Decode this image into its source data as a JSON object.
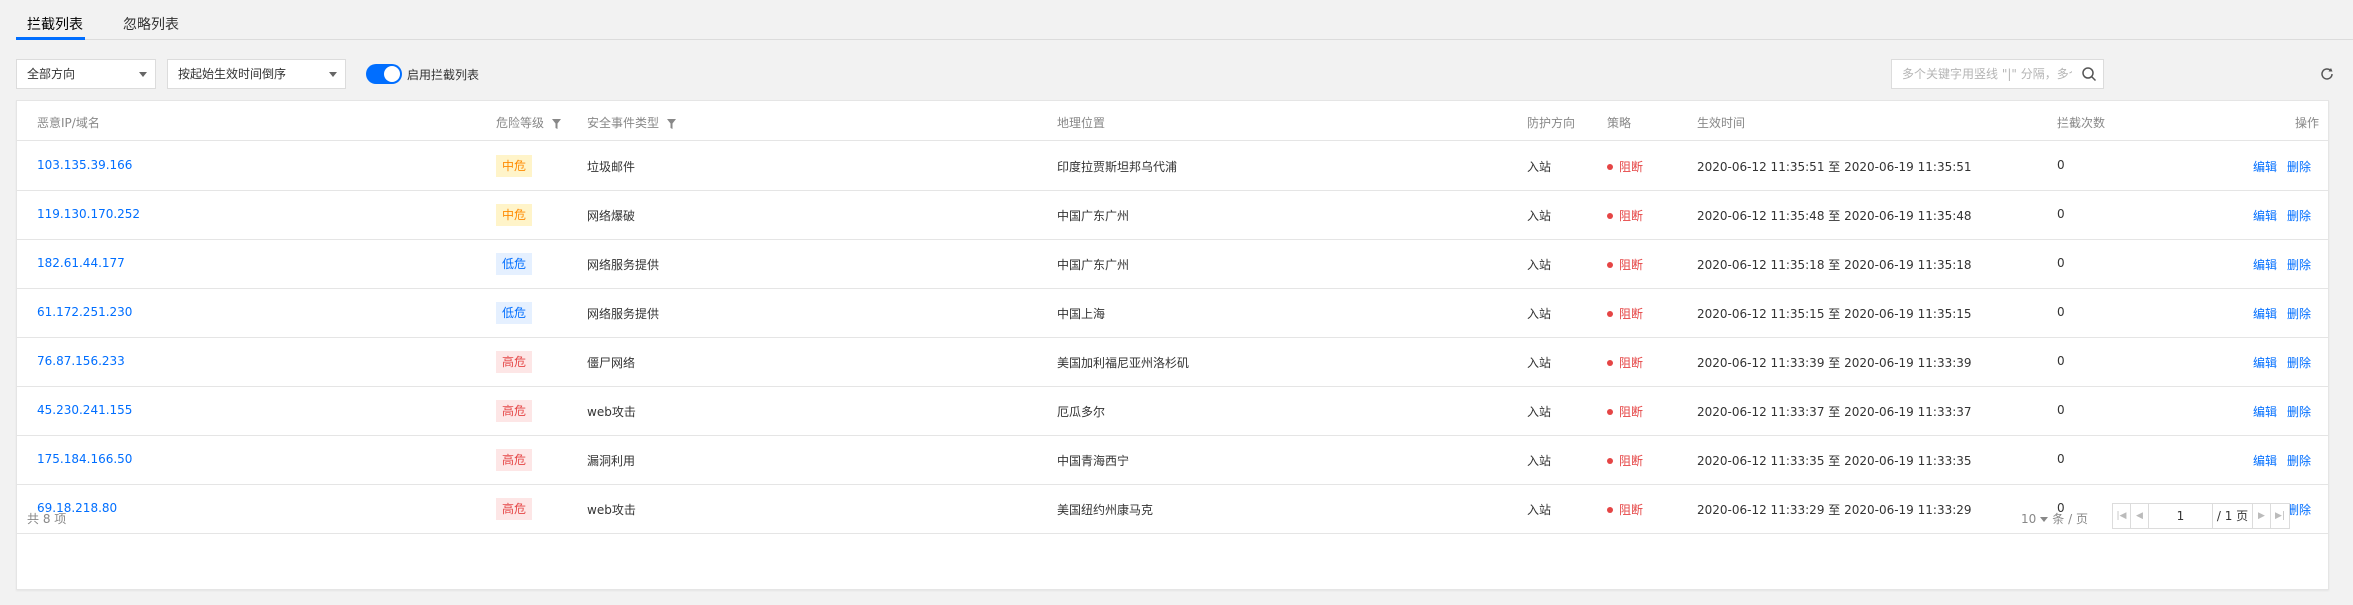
{
  "tabs": [
    {
      "label": "拦截列表",
      "active": true
    },
    {
      "label": "忽略列表",
      "active": false
    }
  ],
  "toolbar": {
    "direction_select": "全部方向",
    "sort_select": "按起始生效时间倒序",
    "toggle_label": "启用拦截列表",
    "toggle_on": true,
    "search_placeholder": "多个关键字用竖线 \"|\" 分隔，多个过滤标签用回车键分隔"
  },
  "table": {
    "headers": {
      "ip": "恶意IP/域名",
      "level": "危险等级",
      "type": "安全事件类型",
      "location": "地理位置",
      "direction": "防护方向",
      "strategy": "策略",
      "time": "生效时间",
      "count": "拦截次数",
      "action": "操作"
    },
    "rows": [
      {
        "ip": "103.135.39.166",
        "level": "中危",
        "level_class": "medium",
        "type": "垃圾邮件",
        "location": "印度拉贾斯坦邦乌代浦",
        "direction": "入站",
        "strategy": "阻断",
        "time": "2020-06-12 11:35:51 至 2020-06-19 11:35:51",
        "count": "0",
        "edit": "编辑",
        "delete": "删除"
      },
      {
        "ip": "119.130.170.252",
        "level": "中危",
        "level_class": "medium",
        "type": "网络爆破",
        "location": "中国广东广州",
        "direction": "入站",
        "strategy": "阻断",
        "time": "2020-06-12 11:35:48 至 2020-06-19 11:35:48",
        "count": "0",
        "edit": "编辑",
        "delete": "删除"
      },
      {
        "ip": "182.61.44.177",
        "level": "低危",
        "level_class": "low",
        "type": "网络服务提供",
        "location": "中国广东广州",
        "direction": "入站",
        "strategy": "阻断",
        "time": "2020-06-12 11:35:18 至 2020-06-19 11:35:18",
        "count": "0",
        "edit": "编辑",
        "delete": "删除"
      },
      {
        "ip": "61.172.251.230",
        "level": "低危",
        "level_class": "low",
        "type": "网络服务提供",
        "location": "中国上海",
        "direction": "入站",
        "strategy": "阻断",
        "time": "2020-06-12 11:35:15 至 2020-06-19 11:35:15",
        "count": "0",
        "edit": "编辑",
        "delete": "删除"
      },
      {
        "ip": "76.87.156.233",
        "level": "高危",
        "level_class": "high",
        "type": "僵尸网络",
        "location": "美国加利福尼亚州洛杉矶",
        "direction": "入站",
        "strategy": "阻断",
        "time": "2020-06-12 11:33:39 至 2020-06-19 11:33:39",
        "count": "0",
        "edit": "编辑",
        "delete": "删除"
      },
      {
        "ip": "45.230.241.155",
        "level": "高危",
        "level_class": "high",
        "type": "web攻击",
        "location": "厄瓜多尔",
        "direction": "入站",
        "strategy": "阻断",
        "time": "2020-06-12 11:33:37 至 2020-06-19 11:33:37",
        "count": "0",
        "edit": "编辑",
        "delete": "删除"
      },
      {
        "ip": "175.184.166.50",
        "level": "高危",
        "level_class": "high",
        "type": "漏洞利用",
        "location": "中国青海西宁",
        "direction": "入站",
        "strategy": "阻断",
        "time": "2020-06-12 11:33:35 至 2020-06-19 11:33:35",
        "count": "0",
        "edit": "编辑",
        "delete": "删除"
      },
      {
        "ip": "69.18.218.80",
        "level": "高危",
        "level_class": "high",
        "type": "web攻击",
        "location": "美国纽约州康马克",
        "direction": "入站",
        "strategy": "阻断",
        "time": "2020-06-12 11:33:29 至 2020-06-19 11:33:29",
        "count": "0",
        "edit": "编辑",
        "delete": "删除"
      }
    ]
  },
  "footer": {
    "total": "共 8 项",
    "page_size": "10",
    "page_size_unit": "条 / 页",
    "current_page": "1",
    "total_pages": "/ 1 页"
  },
  "colors": {
    "accent": "#006eff",
    "danger": "#e54545",
    "warning": "#ff8a00"
  }
}
